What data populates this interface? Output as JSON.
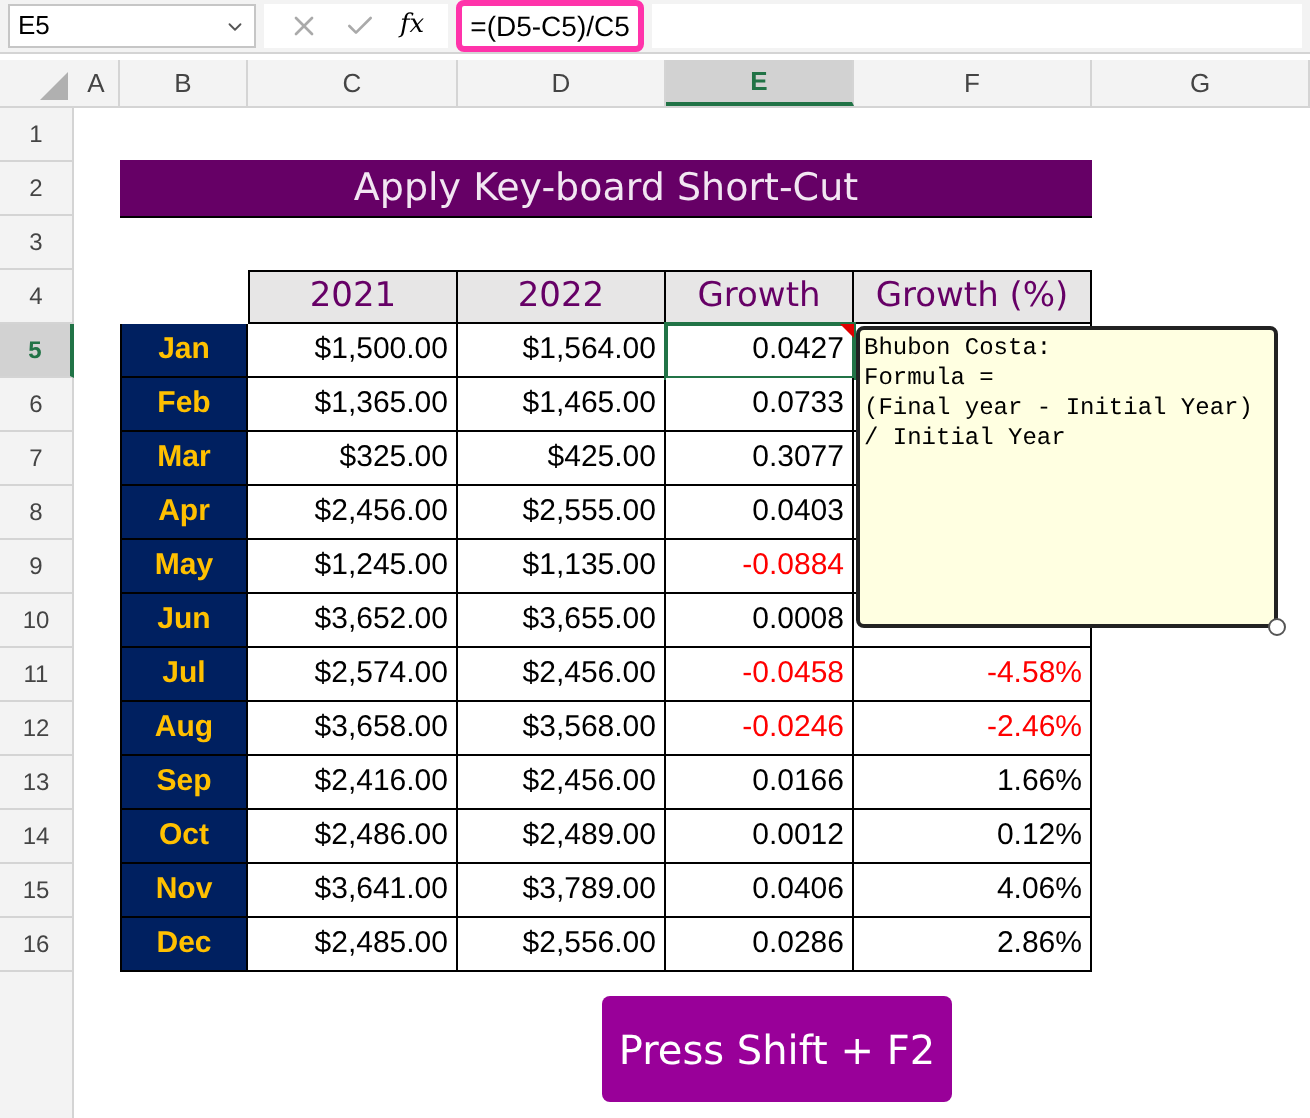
{
  "name_box": "E5",
  "formula_bar": {
    "fx": "fx",
    "formula": "=(D5-C5)/C5"
  },
  "columns": [
    {
      "label": "A",
      "selected": false
    },
    {
      "label": "B",
      "selected": false
    },
    {
      "label": "C",
      "selected": false
    },
    {
      "label": "D",
      "selected": false
    },
    {
      "label": "E",
      "selected": true
    },
    {
      "label": "F",
      "selected": false
    },
    {
      "label": "G",
      "selected": false
    }
  ],
  "row_numbers": [
    {
      "label": "1",
      "selected": false
    },
    {
      "label": "2",
      "selected": false
    },
    {
      "label": "3",
      "selected": false
    },
    {
      "label": "4",
      "selected": false
    },
    {
      "label": "5",
      "selected": true
    },
    {
      "label": "6",
      "selected": false
    },
    {
      "label": "7",
      "selected": false
    },
    {
      "label": "8",
      "selected": false
    },
    {
      "label": "9",
      "selected": false
    },
    {
      "label": "10",
      "selected": false
    },
    {
      "label": "11",
      "selected": false
    },
    {
      "label": "12",
      "selected": false
    },
    {
      "label": "13",
      "selected": false
    },
    {
      "label": "14",
      "selected": false
    },
    {
      "label": "15",
      "selected": false
    },
    {
      "label": "16",
      "selected": false
    }
  ],
  "title": "Apply Key-board Short-Cut",
  "table": {
    "headers": [
      "2021",
      "2022",
      "Growth",
      "Growth (%)"
    ],
    "rows": [
      {
        "month": "Jan",
        "y2021": "$1,500.00",
        "y2022": "$1,564.00",
        "growth": "0.0427",
        "negative": false,
        "selected": true
      },
      {
        "month": "Feb",
        "y2021": "$1,365.00",
        "y2022": "$1,465.00",
        "growth": "0.0733",
        "negative": false,
        "selected": false
      },
      {
        "month": "Mar",
        "y2021": "$325.00",
        "y2022": "$425.00",
        "growth": "0.3077",
        "negative": false,
        "selected": false
      },
      {
        "month": "Apr",
        "y2021": "$2,456.00",
        "y2022": "$2,555.00",
        "growth": "0.0403",
        "negative": false,
        "selected": false
      },
      {
        "month": "May",
        "y2021": "$1,245.00",
        "y2022": "$1,135.00",
        "growth": "-0.0884",
        "negative": true,
        "selected": false
      },
      {
        "month": "Jun",
        "y2021": "$3,652.00",
        "y2022": "$3,655.00",
        "growth": "0.0008",
        "negative": false,
        "selected": false
      },
      {
        "month": "Jul",
        "y2021": "$2,574.00",
        "y2022": "$2,456.00",
        "growth": "-0.0458",
        "growth_pct": "-4.58%",
        "negative": true,
        "selected": false
      },
      {
        "month": "Aug",
        "y2021": "$3,658.00",
        "y2022": "$3,568.00",
        "growth": "-0.0246",
        "growth_pct": "-2.46%",
        "negative": true,
        "selected": false
      },
      {
        "month": "Sep",
        "y2021": "$2,416.00",
        "y2022": "$2,456.00",
        "growth": "0.0166",
        "growth_pct": "1.66%",
        "negative": false,
        "selected": false
      },
      {
        "month": "Oct",
        "y2021": "$2,486.00",
        "y2022": "$2,489.00",
        "growth": "0.0012",
        "growth_pct": "0.12%",
        "negative": false,
        "selected": false
      },
      {
        "month": "Nov",
        "y2021": "$3,641.00",
        "y2022": "$3,789.00",
        "growth": "0.0406",
        "growth_pct": "4.06%",
        "negative": false,
        "selected": false
      },
      {
        "month": "Dec",
        "y2021": "$2,485.00",
        "y2022": "$2,556.00",
        "growth": "0.0286",
        "growth_pct": "2.86%",
        "negative": false,
        "selected": false
      }
    ]
  },
  "comment": {
    "lines": [
      "Bhubon Costa:",
      "Formula =",
      "(Final year - Initial Year)",
      "/ Initial Year"
    ]
  },
  "button": "Press Shift + F2"
}
